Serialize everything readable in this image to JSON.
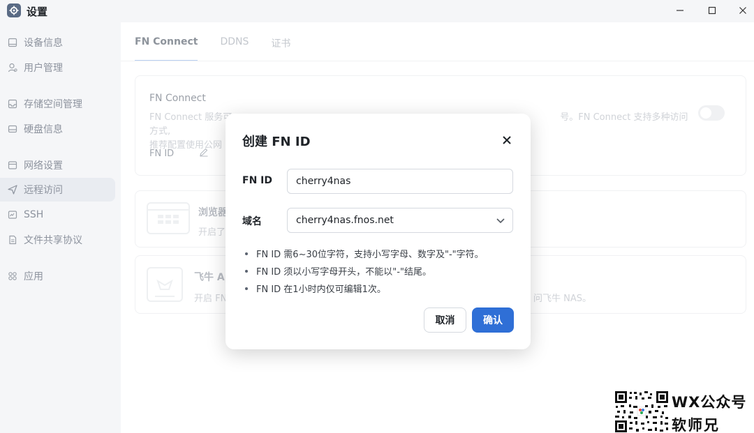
{
  "window": {
    "title": "设置"
  },
  "sidebar": {
    "items": [
      {
        "label": "设备信息",
        "icon": "device-icon"
      },
      {
        "label": "用户管理",
        "icon": "user-icon"
      },
      {
        "label": "存储空间管理",
        "icon": "storage-icon"
      },
      {
        "label": "硬盘信息",
        "icon": "disk-icon"
      },
      {
        "label": "网络设置",
        "icon": "network-icon"
      },
      {
        "label": "远程访问",
        "icon": "send-icon",
        "active": true
      },
      {
        "label": "SSH",
        "icon": "terminal-icon"
      },
      {
        "label": "文件共享协议",
        "icon": "document-icon"
      },
      {
        "label": "应用",
        "icon": "apps-icon"
      }
    ]
  },
  "tabs": [
    {
      "label": "FN Connect",
      "active": true
    },
    {
      "label": "DDNS"
    },
    {
      "label": "证书"
    }
  ],
  "fn_connect_card": {
    "title": "FN Connect",
    "description_line1": "FN Connect 服务可以让您... ...号。FN Connect 支持多种访问方式,",
    "description_left": "FN Connect 服务可",
    "description_right": "号。FN Connect 支持多种访问方式,",
    "description_line2": "推荐配置使用公网",
    "fnid_label": "FN ID"
  },
  "browser_card": {
    "title": "浏览器",
    "description": "开启了"
  },
  "feiniu_card": {
    "title": "飞牛 Ap",
    "description": "开启 FN",
    "description_tail": "问飞牛 NAS。"
  },
  "dialog": {
    "title": "创建 FN ID",
    "fnid_label": "FN ID",
    "fnid_value": "cherry4nas",
    "domain_label": "域名",
    "domain_value": "cherry4nas.fnos.net",
    "hints": [
      "FN ID 需6~30位字符，支持小写字母、数字及\"-\"字符。",
      "FN ID 须以小写字母开头，不能以\"-\"结尾。",
      "FN ID 在1小时内仅可编辑1次。"
    ],
    "cancel_label": "取消",
    "confirm_label": "确认"
  },
  "watermark": {
    "line1": "WX公众号",
    "line2": "软师兄"
  },
  "colors": {
    "primary": "#2f6fd6",
    "sidebar_bg": "#f5f6f8",
    "text": "#1f2328"
  }
}
